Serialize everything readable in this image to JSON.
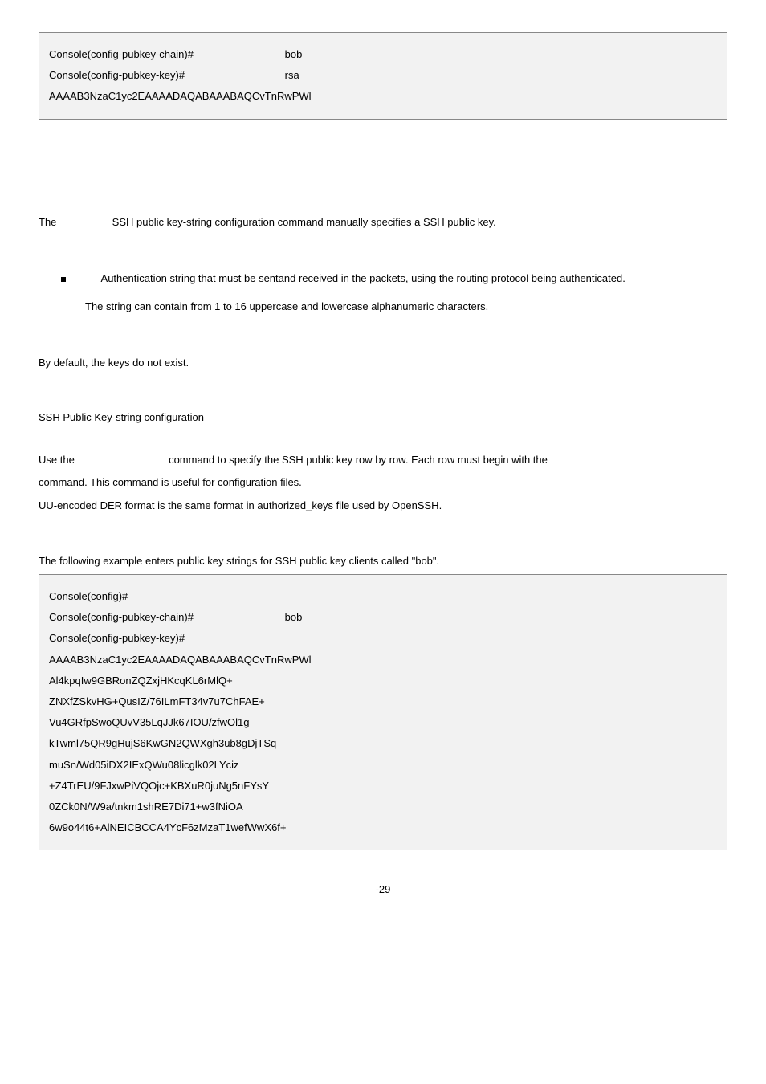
{
  "codebox1": {
    "line1_left": "Console(config-pubkey-chain)#",
    "line1_right": "bob",
    "line2_left": "Console(config-pubkey-key)#",
    "line2_right": "rsa",
    "line3": "AAAAB3NzaC1yc2EAAAADAQABAAABAQCvTnRwPWl"
  },
  "para1": {
    "prefix": "The",
    "rest": "SSH public key-string configuration command manually specifies a SSH public key."
  },
  "bullet": {
    "line1": "— Authentication string that must be sentand received in the packets, using the routing protocol being authenticated.",
    "line2": "The string can contain from 1 to 16 uppercase and lowercase alphanumeric characters."
  },
  "para_default": "By default, the keys do not exist.",
  "para_sshconf": "SSH Public Key-string configuration",
  "para_use": {
    "prefix": "Use the",
    "rest": "command to specify the SSH public key row by row. Each row must begin with the"
  },
  "para_cmd": "command. This command is useful for configuration files.",
  "para_uu": "UU-encoded DER format is the same format in authorized_keys file used by OpenSSH.",
  "para_example": "The following example enters public key strings for SSH public key clients called \"bob\".",
  "codebox2": {
    "l1": "Console(config)#",
    "l2_left": "Console(config-pubkey-chain)#",
    "l2_right": "bob",
    "l3": "Console(config-pubkey-key)#",
    "l4": "AAAAB3NzaC1yc2EAAAADAQABAAABAQCvTnRwPWl",
    "l5": "Al4kpqIw9GBRonZQZxjHKcqKL6rMlQ+",
    "l6": "ZNXfZSkvHG+QusIZ/76ILmFT34v7u7ChFAE+",
    "l7": "Vu4GRfpSwoQUvV35LqJJk67IOU/zfwOl1g",
    "l8": "kTwml75QR9gHujS6KwGN2QWXgh3ub8gDjTSq",
    "l9": "muSn/Wd05iDX2IExQWu08licglk02LYciz",
    "l10": "+Z4TrEU/9FJxwPiVQOjc+KBXuR0juNg5nFYsY",
    "l11": "0ZCk0N/W9a/tnkm1shRE7Di71+w3fNiOA",
    "l12": "6w9o44t6+AlNEICBCCA4YcF6zMzaT1wefWwX6f+"
  },
  "pagenum": "-29"
}
